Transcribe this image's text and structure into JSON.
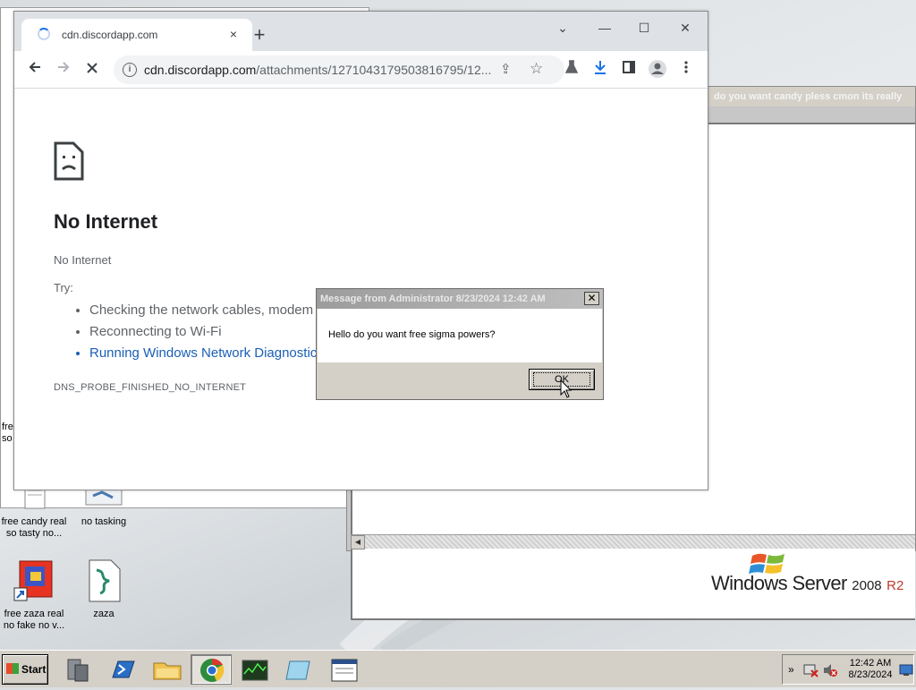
{
  "desktop": {
    "icons": [
      {
        "label_line1": "free candy real",
        "label_line2": "so tasty no..."
      },
      {
        "label_line1": "no tasking",
        "label_line2": ""
      },
      {
        "label_line1": "free zaza real",
        "label_line2": "no fake no v..."
      },
      {
        "label_line1": "zaza",
        "label_line2": ""
      }
    ],
    "partial_label_1": "fre",
    "partial_label_2": "so",
    "windows_brand": "Windows Server",
    "windows_version": "2008",
    "windows_r2": "R2"
  },
  "background_window": {
    "title": "do you want candy pless cmon its really"
  },
  "browser": {
    "tab_title": "cdn.discordapp.com",
    "tab_close": "×",
    "new_tab": "+",
    "url_host": "cdn.discordapp.com",
    "url_path": "/attachments/1271043179503816795/12...",
    "window_controls": {
      "chevron": "⌄",
      "minimize": "—",
      "maximize": "☐",
      "close": "✕"
    }
  },
  "error_page": {
    "title": "No Internet",
    "subtitle": "No Internet",
    "try_label": "Try:",
    "suggestions": [
      "Checking the network cables, modem a",
      "Reconnecting to Wi-Fi",
      "Running Windows Network Diagnostic"
    ],
    "error_code": "DNS_PROBE_FINISHED_NO_INTERNET"
  },
  "message_box": {
    "title": "Message from Administrator 8/23/2024 12:42 AM",
    "text": "Hello do you want free sigma powers?",
    "ok_label": "OK",
    "close_glyph": "✕"
  },
  "taskbar": {
    "start_label": "Start",
    "clock_time": "12:42 AM",
    "clock_date": "8/23/2024",
    "tray_chevron": "»"
  },
  "colors": {
    "chrome_tabstrip": "#dee1e6",
    "link_blue": "#1a5fb4",
    "classic_face": "#d4d0c8"
  }
}
